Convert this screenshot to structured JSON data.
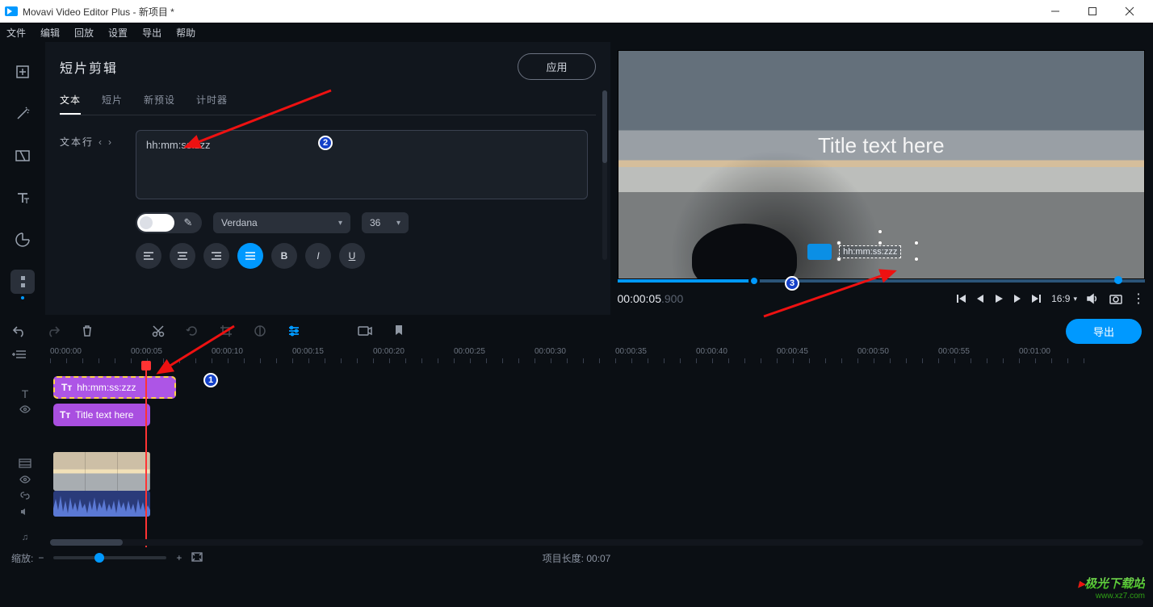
{
  "window": {
    "title": "Movavi Video Editor Plus - 新项目 *"
  },
  "menu": [
    "文件",
    "编辑",
    "回放",
    "设置",
    "导出",
    "帮助"
  ],
  "panel": {
    "title": "短片剪辑",
    "apply": "应用",
    "tabs": [
      "文本",
      "短片",
      "新预设",
      "计时器"
    ],
    "active_tab": 0,
    "text_row_label": "文本行",
    "text_value": "hh:mm:ss:zzz",
    "font": "Verdana",
    "font_size": "36"
  },
  "preview": {
    "title_overlay": "Title text here",
    "timer_overlay": "hh:mm:ss:zzz",
    "time_main": "00:00:05",
    "time_ms": ".900",
    "aspect": "16:9"
  },
  "toolbar": {
    "export": "导出"
  },
  "timeline": {
    "labels": [
      "00:00:00",
      "00:00:05",
      "00:00:10",
      "00:00:15",
      "00:00:20",
      "00:00:25",
      "00:00:30",
      "00:00:35",
      "00:00:40",
      "00:00:45",
      "00:00:50",
      "00:00:55",
      "00:01:00"
    ],
    "clip_a": "hh:mm:ss:zzz",
    "clip_b": "Title text here"
  },
  "status": {
    "zoom_label": "缩放:",
    "project_len_label": "项目长度:",
    "project_len_value": "00:07"
  },
  "watermark": {
    "name": "极光下载站",
    "url": "www.xz7.com"
  }
}
